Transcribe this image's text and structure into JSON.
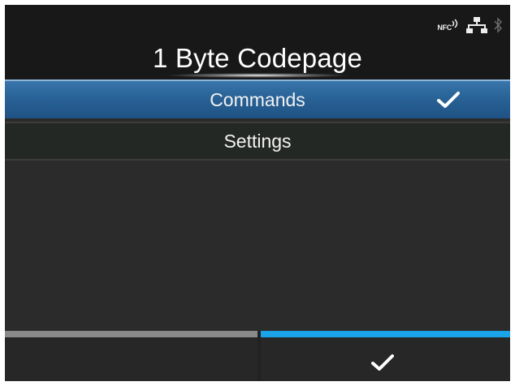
{
  "header": {
    "title": "1 Byte Codepage",
    "status_icons": {
      "nfc_label": "NFC",
      "icons": [
        "nfc-icon",
        "lan-icon",
        "bluetooth-icon"
      ]
    }
  },
  "menu": {
    "items": [
      {
        "label": "Commands",
        "selected": true,
        "icon": "check-icon"
      },
      {
        "label": "Settings",
        "selected": false
      }
    ]
  },
  "softkeys": {
    "left": {
      "label": ""
    },
    "right": {
      "icon": "check-icon"
    }
  },
  "colors": {
    "selection": "#2a6498",
    "confirm_accent": "#1aa3e8",
    "inactive_accent": "#8a8a8a",
    "background": "#2b2b2b"
  }
}
